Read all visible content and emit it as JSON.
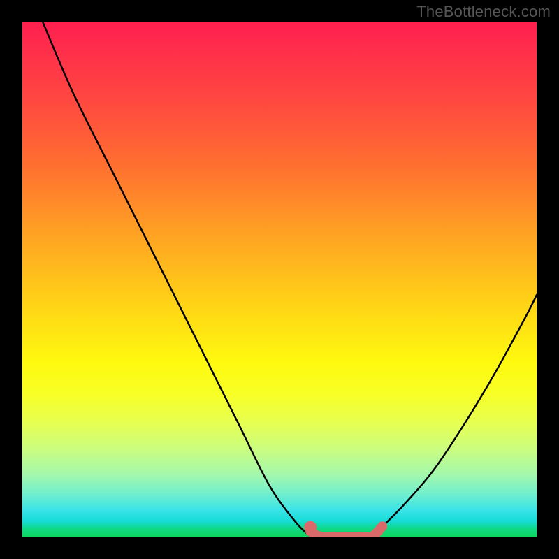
{
  "watermark": "TheBottleneck.com",
  "chart_data": {
    "type": "line",
    "title": "",
    "xlabel": "",
    "ylabel": "",
    "xlim": [
      0,
      100
    ],
    "ylim": [
      0,
      100
    ],
    "series": [
      {
        "name": "left-branch",
        "x": [
          4,
          10,
          18,
          26,
          34,
          42,
          48,
          53,
          56
        ],
        "y": [
          100,
          86,
          70,
          54,
          38,
          22,
          10,
          3,
          0
        ]
      },
      {
        "name": "right-branch",
        "x": [
          68,
          74,
          80,
          86,
          92,
          98,
          100
        ],
        "y": [
          0,
          6,
          13,
          22,
          32,
          43,
          47
        ]
      },
      {
        "name": "highlight-flat",
        "x": [
          56,
          58,
          62,
          66,
          68,
          70
        ],
        "y": [
          1,
          0,
          0,
          0,
          0,
          2
        ]
      }
    ],
    "colors": {
      "curve": "#000000",
      "highlight": "#d86a6a",
      "gradient_top": "#ff1f4f",
      "gradient_bottom": "#0ed65e"
    }
  }
}
